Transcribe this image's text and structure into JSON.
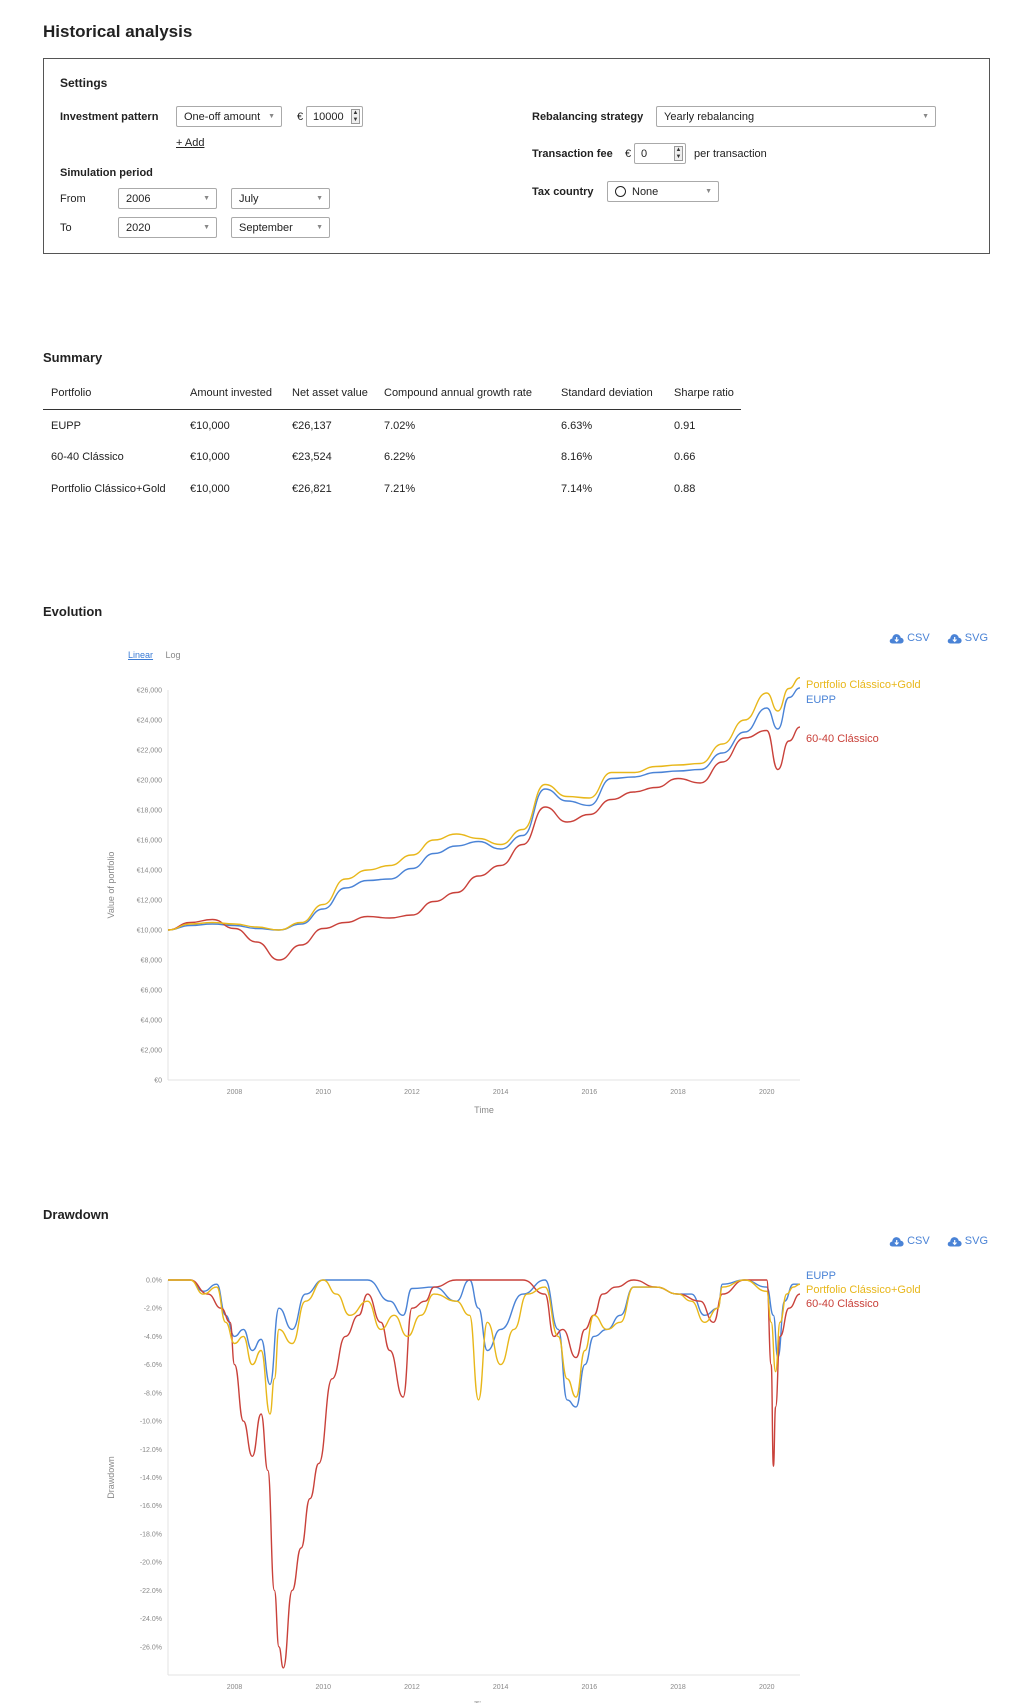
{
  "page_title": "Historical analysis",
  "settings": {
    "heading": "Settings",
    "investment_pattern_label": "Investment pattern",
    "investment_pattern_value": "One-off amount",
    "currency_symbol": "€",
    "amount_value": "10000",
    "add_label": "+ Add",
    "simulation_period_label": "Simulation period",
    "from_label": "From",
    "from_year": "2006",
    "from_month": "July",
    "to_label": "To",
    "to_year": "2020",
    "to_month": "September",
    "rebalancing_label": "Rebalancing strategy",
    "rebalancing_value": "Yearly rebalancing",
    "fee_label": "Transaction fee",
    "fee_value": "0",
    "fee_suffix": "per transaction",
    "tax_label": "Tax country",
    "tax_value": "None"
  },
  "summary": {
    "title": "Summary",
    "columns": [
      "Portfolio",
      "Amount invested",
      "Net asset value",
      "Compound annual growth rate",
      "Standard deviation",
      "Sharpe ratio"
    ],
    "rows": [
      [
        "EUPP",
        "€10,000",
        "€26,137",
        "7.02%",
        "6.63%",
        "0.91"
      ],
      [
        "60-40 Clássico",
        "€10,000",
        "€23,524",
        "6.22%",
        "8.16%",
        "0.66"
      ],
      [
        "Portfolio Clássico+Gold",
        "€10,000",
        "€26,821",
        "7.21%",
        "7.14%",
        "0.88"
      ]
    ]
  },
  "downloads": {
    "csv": "CSV",
    "svg": "SVG"
  },
  "evolution": {
    "title": "Evolution",
    "scale_linear": "Linear",
    "scale_log": "Log"
  },
  "drawdown": {
    "title": "Drawdown"
  },
  "colors": {
    "eupp": "#4a83d6",
    "classico": "#c9413a",
    "gold": "#e8b71a",
    "link": "#3a7bd5"
  },
  "chart_data": [
    {
      "type": "line",
      "title": "Evolution",
      "xlabel": "Time",
      "ylabel": "Value of portfolio",
      "xlim": [
        2006.5,
        2020.75
      ],
      "ylim": [
        0,
        26000
      ],
      "xticks": [
        2008,
        2010,
        2012,
        2014,
        2016,
        2018,
        2020
      ],
      "yticks": [
        0,
        2000,
        4000,
        6000,
        8000,
        10000,
        12000,
        14000,
        16000,
        18000,
        20000,
        22000,
        24000,
        26000
      ],
      "ytick_labels": [
        "€0",
        "€2,000",
        "€4,000",
        "€6,000",
        "€8,000",
        "€10,000",
        "€12,000",
        "€14,000",
        "€16,000",
        "€18,000",
        "€20,000",
        "€22,000",
        "€24,000",
        "€26,000"
      ],
      "grid": false,
      "legend": "right-end labels",
      "series": [
        {
          "name": "EUPP",
          "color": "#4a83d6",
          "x": [
            2006.5,
            2007.0,
            2007.5,
            2008.0,
            2008.5,
            2009.0,
            2009.5,
            2010.0,
            2010.5,
            2011.0,
            2011.5,
            2012.0,
            2012.5,
            2013.0,
            2013.5,
            2014.0,
            2014.5,
            2015.0,
            2015.5,
            2016.0,
            2016.5,
            2017.0,
            2017.5,
            2018.0,
            2018.5,
            2019.0,
            2019.5,
            2020.0,
            2020.25,
            2020.5,
            2020.75
          ],
          "y": [
            10000,
            10300,
            10400,
            10300,
            10100,
            10000,
            10400,
            11400,
            12800,
            13300,
            13400,
            14100,
            15100,
            15600,
            15900,
            15400,
            16300,
            19400,
            18600,
            18300,
            20100,
            20200,
            20500,
            20600,
            20700,
            21800,
            23200,
            24800,
            23400,
            25500,
            26137
          ]
        },
        {
          "name": "60-40 Clássico",
          "color": "#c9413a",
          "x": [
            2006.5,
            2007.0,
            2007.5,
            2008.0,
            2008.5,
            2009.0,
            2009.5,
            2010.0,
            2010.5,
            2011.0,
            2011.5,
            2012.0,
            2012.5,
            2013.0,
            2013.5,
            2014.0,
            2014.5,
            2015.0,
            2015.5,
            2016.0,
            2016.5,
            2017.0,
            2017.5,
            2018.0,
            2018.5,
            2019.0,
            2019.5,
            2020.0,
            2020.25,
            2020.5,
            2020.75
          ],
          "y": [
            10000,
            10500,
            10700,
            10100,
            9200,
            8000,
            9000,
            10100,
            10500,
            10900,
            10800,
            11000,
            11900,
            12500,
            13600,
            14300,
            15700,
            18200,
            17200,
            17700,
            18700,
            19200,
            19500,
            20100,
            19800,
            21200,
            22800,
            23300,
            20700,
            22600,
            23524
          ]
        },
        {
          "name": "Portfolio Clássico+Gold",
          "color": "#e8b71a",
          "x": [
            2006.5,
            2007.0,
            2007.5,
            2008.0,
            2008.5,
            2009.0,
            2009.5,
            2010.0,
            2010.5,
            2011.0,
            2011.5,
            2012.0,
            2012.5,
            2013.0,
            2013.5,
            2014.0,
            2014.5,
            2015.0,
            2015.5,
            2016.0,
            2016.5,
            2017.0,
            2017.5,
            2018.0,
            2018.5,
            2019.0,
            2019.5,
            2020.0,
            2020.25,
            2020.5,
            2020.75
          ],
          "y": [
            10000,
            10400,
            10500,
            10400,
            10200,
            10000,
            10500,
            11700,
            13400,
            14000,
            14300,
            15000,
            16000,
            16400,
            16100,
            15700,
            16700,
            19700,
            18900,
            18800,
            20500,
            20500,
            20900,
            21000,
            21100,
            22400,
            24000,
            25800,
            24600,
            26100,
            26821
          ]
        }
      ]
    },
    {
      "type": "line",
      "title": "Drawdown",
      "xlabel": "Time",
      "ylabel": "Drawdown",
      "xlim": [
        2006.5,
        2020.75
      ],
      "ylim": [
        -28,
        0
      ],
      "xticks": [
        2008,
        2010,
        2012,
        2014,
        2016,
        2018,
        2020
      ],
      "yticks": [
        0,
        -2,
        -4,
        -6,
        -8,
        -10,
        -12,
        -14,
        -16,
        -18,
        -20,
        -22,
        -24,
        -26
      ],
      "ytick_labels": [
        "0.0%",
        "-2.0%",
        "-4.0%",
        "-6.0%",
        "-8.0%",
        "-10.0%",
        "-12.0%",
        "-14.0%",
        "-16.0%",
        "-18.0%",
        "-20.0%",
        "-22.0%",
        "-24.0%",
        "-26.0%"
      ],
      "grid": false,
      "legend": "top-right",
      "series": [
        {
          "name": "EUPP",
          "color": "#4a83d6",
          "x": [
            2006.5,
            2007.0,
            2007.3,
            2007.6,
            2007.8,
            2008.0,
            2008.2,
            2008.4,
            2008.6,
            2008.8,
            2009.0,
            2009.3,
            2009.6,
            2010.0,
            2010.5,
            2011.0,
            2011.5,
            2011.8,
            2012.0,
            2012.5,
            2013.0,
            2013.3,
            2013.5,
            2013.7,
            2014.0,
            2014.5,
            2015.0,
            2015.3,
            2015.5,
            2015.7,
            2015.9,
            2016.1,
            2016.4,
            2016.7,
            2017.0,
            2017.5,
            2018.0,
            2018.3,
            2018.6,
            2018.9,
            2019.0,
            2019.5,
            2020.0,
            2020.15,
            2020.25,
            2020.4,
            2020.6,
            2020.75
          ],
          "y": [
            0,
            0,
            -0.8,
            -0.3,
            -2.5,
            -4.0,
            -3.5,
            -5.0,
            -4.2,
            -7.4,
            -2.0,
            -3.5,
            -1.0,
            0,
            0,
            0,
            -1.5,
            -2.5,
            -0.6,
            -0.5,
            -1.5,
            0,
            -2.0,
            -5.0,
            -3.5,
            -1.0,
            0,
            -3.5,
            -8.5,
            -9.0,
            -6.0,
            -4.0,
            -3.5,
            -2.5,
            -0.5,
            -0.5,
            -1.0,
            -1.0,
            -2.5,
            -2.0,
            -0.3,
            0,
            -0.5,
            -2.5,
            -5.5,
            -1.5,
            -0.3,
            -0.3
          ]
        },
        {
          "name": "60-40 Clássico",
          "color": "#c9413a",
          "x": [
            2006.5,
            2007.0,
            2007.4,
            2007.7,
            2007.9,
            2008.0,
            2008.2,
            2008.4,
            2008.6,
            2008.75,
            2008.9,
            2009.0,
            2009.1,
            2009.3,
            2009.5,
            2009.7,
            2009.9,
            2010.2,
            2010.5,
            2010.8,
            2011.0,
            2011.3,
            2011.5,
            2011.8,
            2012.0,
            2012.3,
            2012.5,
            2013.0,
            2013.5,
            2014.0,
            2014.5,
            2015.0,
            2015.2,
            2015.4,
            2015.7,
            2015.9,
            2016.1,
            2016.3,
            2016.6,
            2017.0,
            2017.5,
            2018.0,
            2018.5,
            2018.8,
            2019.0,
            2019.5,
            2020.0,
            2020.1,
            2020.15,
            2020.2,
            2020.3,
            2020.5,
            2020.75
          ],
          "y": [
            0,
            0,
            -1.0,
            -2.0,
            -3.0,
            -6.0,
            -10.0,
            -12.5,
            -9.5,
            -13.5,
            -22.0,
            -26.0,
            -27.5,
            -22.0,
            -19.0,
            -15.5,
            -13.0,
            -7.0,
            -4.0,
            -2.5,
            -1.0,
            -3.0,
            -5.0,
            -8.3,
            -2.0,
            -1.5,
            -0.5,
            0,
            0,
            0,
            0,
            -1.0,
            -4.0,
            -3.5,
            -5.5,
            -3.5,
            -2.5,
            -1.0,
            -0.5,
            0,
            -0.5,
            -1.0,
            -1.5,
            -3.0,
            -1.0,
            0,
            0,
            -6.0,
            -13.2,
            -9.0,
            -4.0,
            -2.0,
            -1.0
          ]
        },
        {
          "name": "Portfolio Clássico+Gold",
          "color": "#e8b71a",
          "x": [
            2006.5,
            2007.0,
            2007.3,
            2007.6,
            2007.8,
            2008.0,
            2008.2,
            2008.4,
            2008.6,
            2008.8,
            2008.9,
            2009.0,
            2009.3,
            2009.6,
            2010.0,
            2010.3,
            2010.6,
            2011.0,
            2011.3,
            2011.6,
            2011.9,
            2012.2,
            2012.5,
            2013.0,
            2013.3,
            2013.5,
            2013.7,
            2014.0,
            2014.3,
            2014.6,
            2015.0,
            2015.3,
            2015.5,
            2015.7,
            2015.9,
            2016.1,
            2016.4,
            2016.7,
            2017.0,
            2017.5,
            2018.0,
            2018.3,
            2018.6,
            2018.9,
            2019.0,
            2019.5,
            2020.0,
            2020.1,
            2020.2,
            2020.3,
            2020.45,
            2020.6,
            2020.75
          ],
          "y": [
            0,
            0,
            -1.0,
            -0.5,
            -3.0,
            -4.5,
            -4.0,
            -6.0,
            -5.0,
            -9.5,
            -7.0,
            -3.5,
            -4.5,
            -1.5,
            0,
            -1.0,
            -2.5,
            -1.5,
            -3.5,
            -2.5,
            -4.0,
            -2.5,
            -1.0,
            -1.5,
            -2.5,
            -8.5,
            -3.0,
            -6.0,
            -3.5,
            -1.0,
            -0.5,
            -4.0,
            -7.0,
            -8.3,
            -5.0,
            -2.5,
            -3.5,
            -3.0,
            -0.5,
            -0.5,
            -1.0,
            -1.5,
            -3.0,
            -2.0,
            -0.5,
            0,
            -0.8,
            -3.0,
            -6.5,
            -3.0,
            -1.0,
            -0.5,
            -0.3
          ]
        }
      ]
    }
  ]
}
